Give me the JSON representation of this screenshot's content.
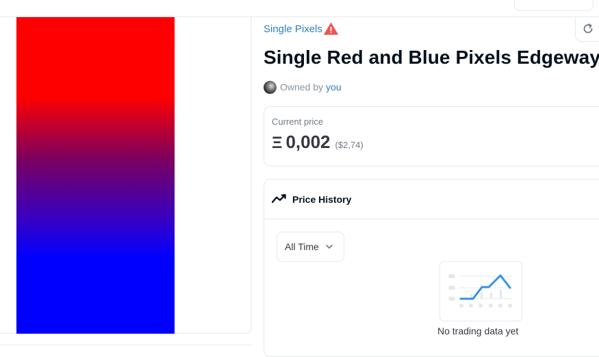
{
  "top_bar": {
    "button_label": ""
  },
  "asset": {
    "collection_name": "Single Pixels",
    "collection_warning_icon": "warning-triangle-icon",
    "title": "Single Red and Blue Pixels Edgeways",
    "owned_by_label": "Owned by",
    "owner_name": "you",
    "artwork_colors": {
      "top": "#ff0000",
      "bottom": "#0000ff"
    }
  },
  "price": {
    "label": "Current price",
    "currency_symbol": "Ξ",
    "value": "0,002",
    "fiat": "($2,74)"
  },
  "price_history": {
    "title": "Price History",
    "icon": "trending-line-icon",
    "range_selected": "All Time",
    "empty_message": "No trading data yet"
  },
  "colors": {
    "link": "#2e7ebd",
    "warning": "#eb5757",
    "border": "#e5e8eb",
    "illustration_line": "#3291e9"
  }
}
